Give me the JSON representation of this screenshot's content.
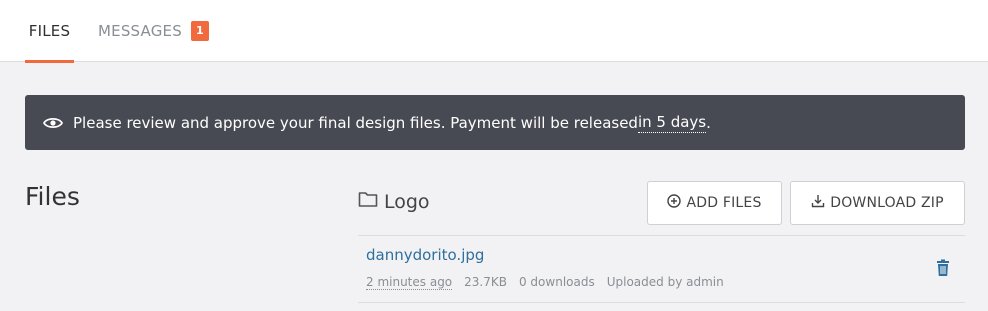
{
  "tabs": {
    "files": "FILES",
    "messages": "MESSAGES",
    "messages_badge": "1"
  },
  "notice": {
    "icon": "eye-icon",
    "text": "Please review and approve your final design files. Payment will be released ",
    "deadline": "in 5 days",
    "suffix": "."
  },
  "files_section": {
    "title": "Files",
    "folder": {
      "icon": "folder-icon",
      "name": "Logo"
    },
    "buttons": {
      "add_files": "ADD FILES",
      "download_zip": "DOWNLOAD ZIP"
    },
    "items": [
      {
        "name": "dannydorito.jpg",
        "uploaded": "2 minutes ago",
        "size": "23.7KB",
        "downloads": "0 downloads",
        "uploaded_by": "Uploaded by admin"
      }
    ]
  },
  "colors": {
    "accent": "#f06a3d",
    "notice_bg": "#474a52",
    "link": "#2e6f9e"
  }
}
